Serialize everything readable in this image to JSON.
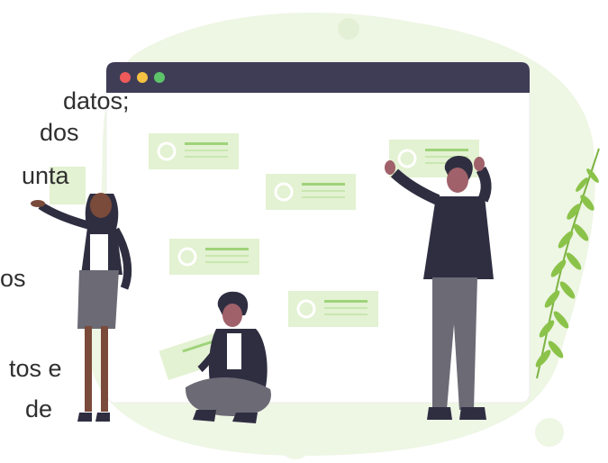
{
  "text_fragments": {
    "line1": "datos;",
    "line2": "dos",
    "line3": "unta",
    "line4": "os",
    "line5": "tos e",
    "line6": "de"
  },
  "illustration": {
    "scene": "team arranging cards on a large browser window",
    "window_dots": [
      "#f05a5a",
      "#f5c242",
      "#5dc46a"
    ],
    "colors": {
      "blob": "#eef6e4",
      "card": "#e3f2d2",
      "card_line": "#9fd37a",
      "window_bar": "#3f3d56",
      "dark": "#2f2e41",
      "skin": "#a0616a",
      "leaf": "#8bc34a"
    }
  }
}
